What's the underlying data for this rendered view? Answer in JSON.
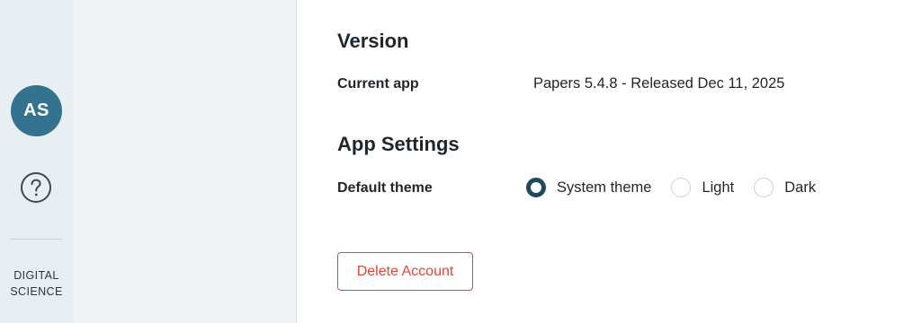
{
  "sidebar": {
    "avatar_initials": "AS",
    "help_icon": "help-circle-icon",
    "brand_line1": "DIGITAL",
    "brand_line2": "SCIENCE"
  },
  "version": {
    "title": "Version",
    "current_app_label": "Current app",
    "current_app_value": "Papers 5.4.8 - Released Dec 11, 2025"
  },
  "app_settings": {
    "title": "App Settings",
    "default_theme_label": "Default theme",
    "theme_options": [
      {
        "label": "System theme",
        "checked": true
      },
      {
        "label": "Light",
        "checked": false
      },
      {
        "label": "Dark",
        "checked": false
      }
    ]
  },
  "actions": {
    "delete_account_label": "Delete Account"
  },
  "colors": {
    "accent": "#33738f",
    "radio_selected": "#1f4a5c",
    "danger": "#e0453a",
    "rail_bg": "#e8eef2",
    "panel_bg": "#eff3f5"
  }
}
